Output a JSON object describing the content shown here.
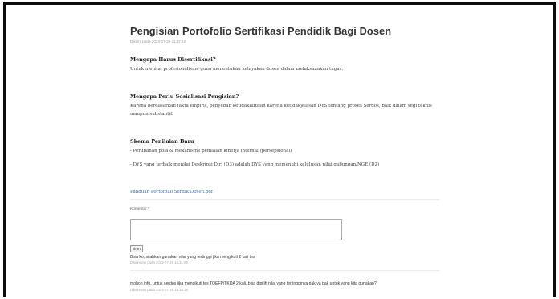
{
  "post": {
    "title": "Pengisian Portofolio Sertifikasi Pendidik Bagi Dosen",
    "meta": "Dikirim pada 2023-07-29 11:47:12"
  },
  "sections": [
    {
      "heading": "Mengapa Harus Disertifikasi?",
      "body": "Untuk menilai profesionalisme guna menentukan kelayakan dosen dalam melaksanakan tugas."
    },
    {
      "heading": "Mengapa Perlu Sosialisasi Pengisian?",
      "body_line1": "Karena berdasarkan fakta empiris, penyebab ketidaklulusan karena ketidakjelasan DYS tentang proses Serdos, baik dalam segi teknis",
      "body_line2": "maupun substantif."
    },
    {
      "heading": "Skema Penilaian Baru",
      "items": [
        "- Perubahan pola & mekanisme penilaian kinerja internal (persepsional)",
        "- DYS yang terbaik menilai Deskripsi Diri (D3) adalah DYS yang memenuhi kelulusan nilai gabungan/NGE (D2)"
      ]
    }
  ],
  "attachment": {
    "label": "Panduan Portofolio Serdik Dosen.pdf"
  },
  "comment_form": {
    "label": "Komentar",
    "required_mark": "*",
    "textarea_value": "",
    "submit_label": "kirim"
  },
  "comments": [
    {
      "text": "Bisa ko, silahkan gunakan nilai yang tertinggi jika mengikuti 2 kali tes",
      "meta": "Dikirimkan pada 2023-07-29 16:31:06"
    },
    {
      "text": "mohon info, untuk serdos jika mengikuti tes TOEFP/TKDA 2 kali, bisa dipilih nilai yang tertingginya gak ya pak untuk yang kita gunakan?",
      "meta": "Dikirimkan pada 2023-07-29 13:16:18"
    }
  ]
}
